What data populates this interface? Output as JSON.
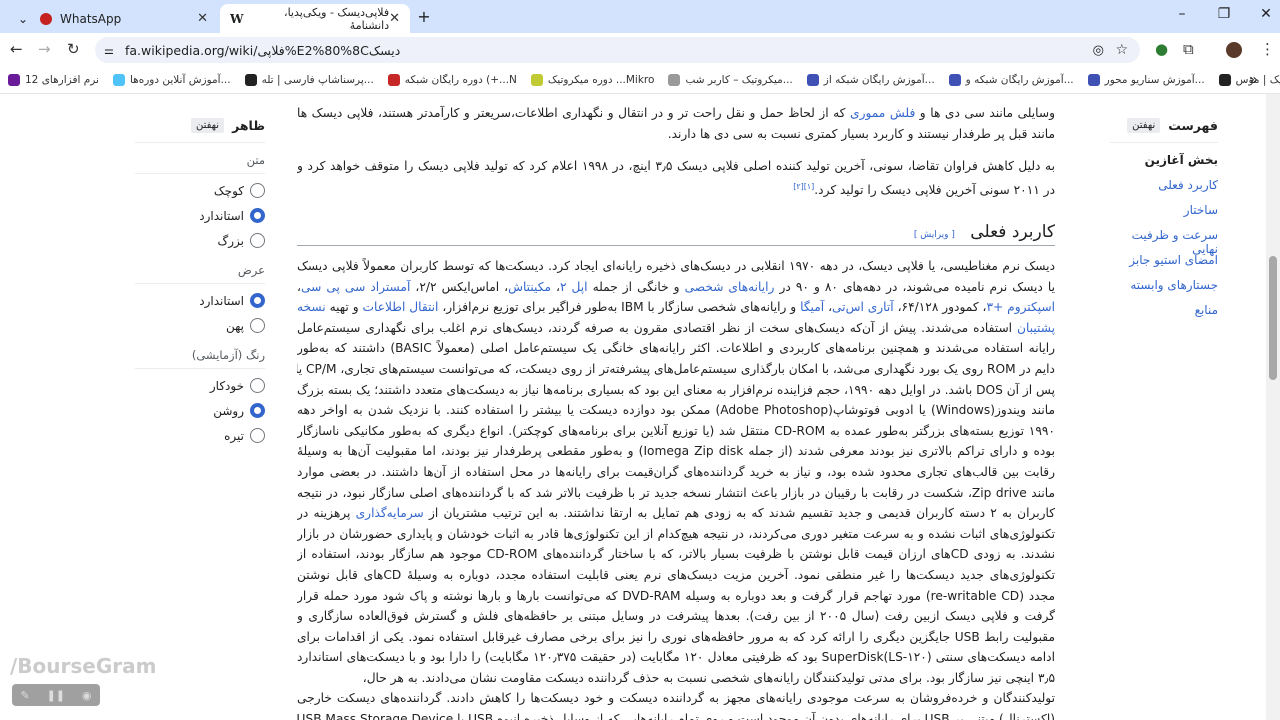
{
  "browser": {
    "tabs": [
      {
        "title": "WhatsApp",
        "active": false
      },
      {
        "title": "فلاپی‌دیسک - ویکی‌پدیا، دانشنامهٔ",
        "active": true
      }
    ],
    "url": "fa.wikipedia.org/wiki/فلاپی%E2%80%8Cدیسک",
    "bookmarks": [
      "نرم افزارهای 12",
      "آموزش آنلاین دوره‌ها...",
      "پرسناشاپ فارسی | تله...",
      "دوره رایگان شبکه (+...N",
      "دوره میکروتیک ...Mikro",
      "میکروتیک – کاربر شب...",
      "آموزش رایگان شبکه از...",
      "آموزش رایگان شبکه و...",
      "آموزش سناریو محور...",
      "یک میکروتیک | مؤس..."
    ],
    "more": "»"
  },
  "appearance": {
    "title": "ظاهر",
    "hide": "نهفتن",
    "groups": [
      {
        "label": "متن",
        "options": [
          {
            "label": "کوچک",
            "on": false
          },
          {
            "label": "استاندارد",
            "on": true
          },
          {
            "label": "بزرگ",
            "on": false
          }
        ]
      },
      {
        "label": "عرض",
        "options": [
          {
            "label": "استاندارد",
            "on": true
          },
          {
            "label": "پهن",
            "on": false
          }
        ]
      },
      {
        "label": "رنگ (آزمایشی)",
        "options": [
          {
            "label": "خودکار",
            "on": false
          },
          {
            "label": "روشن",
            "on": true
          },
          {
            "label": "تیره",
            "on": false
          }
        ]
      }
    ]
  },
  "toc": {
    "title": "فهرست",
    "hide": "نهفتن",
    "items": [
      "بخش آغازین",
      "کاربرد فعلی",
      "ساختار",
      "سرعت و ظرفیت نهایی",
      "امضای استیو جابز",
      "جستارهای وابسته",
      "منابع"
    ]
  },
  "article": {
    "p1": [
      [
        {
          "t": "وسایلی مانند سی دی ها و "
        },
        {
          "t": "فلش مموری",
          "link": true
        },
        {
          "t": " که از لحاظ حمل و نقل راحت تر و در انتقال و نگهداری اطلاعات،سریعتر و کارآمدتر هستند، فلاپی دیسک ها"
        }
      ],
      [
        {
          "t": "مانند قبل پر طرفدار نیستند و کاربرد بسیار کمتری نسبت به سی دی ها دارند."
        }
      ]
    ],
    "p2": [
      [
        {
          "t": "به دلیل کاهش فراوان تقاضا، سونی، آخرین تولید کننده اصلی فلاپی دیسک ۳٫۵ اینچ، در ۱۹۹۸ اعلام کرد که تولید فلاپی دیسک را متوقف خواهد کرد و"
        }
      ],
      [
        {
          "t": "در ۲۰۱۱ سونی آخرین فلاپی دیسک را تولید کرد."
        },
        {
          "t": "[۱][۲]",
          "sup": true
        }
      ]
    ],
    "heading": "کاربرد فعلی",
    "edit": "[ ویرایش ]",
    "p3": [
      [
        {
          "t": "دیسک نرم مغناطیسی، یا فلاپی دیسک، در دهه ۱۹۷۰ انقلابی در دیسک‌های ذخیره رایانه‌ای ایجاد کرد. دیسکت‌ها که توسط کاربران معمولاً فلاپی دیسک"
        }
      ],
      [
        {
          "t": "یا دیسک نرم نامیده می‌شوند، در دهه‌های ۸۰ و ۹۰ در "
        },
        {
          "t": "رایانه‌های شخصی",
          "link": true
        },
        {
          "t": " و خانگی از جمله "
        },
        {
          "t": "اپل ۲",
          "link": true
        },
        {
          "t": "، "
        },
        {
          "t": "مکینتاش",
          "link": true
        },
        {
          "t": "، اماس‌ایکس ۲/۲، "
        },
        {
          "t": "آمستراد سی پی سی",
          "link": true
        },
        {
          "t": "،"
        }
      ],
      [
        {
          "t": "اسپکتروم +۳",
          "link": true
        },
        {
          "t": "، کمودور ۶۴/۱۲۸، "
        },
        {
          "t": "آتاری اس‌تی",
          "link": true
        },
        {
          "t": "، "
        },
        {
          "t": "آمیگا",
          "link": true
        },
        {
          "t": " و رایانه‌های شخصی سازگار با IBM به‌طور فراگیر برای توزیع نرم‌افزار، "
        },
        {
          "t": "انتقال اطلاعات",
          "link": true
        },
        {
          "t": " و تهیه "
        },
        {
          "t": "نسخه",
          "link": true
        }
      ],
      [
        {
          "t": "پشتیبان",
          "link": true
        },
        {
          "t": " استفاده می‌شدند. پیش از آن‌که دیسک‌های سخت از نظر اقتصادی مقرون به صرفه گردند، دیسک‌های نرم اغلب برای نگهداری سیستم‌عامل"
        }
      ],
      [
        {
          "t": "رایانه استفاده می‌شدند و همچنین برنامه‌های کاربردی و اطلاعات. اکثر رایانه‌های خانگی یک سیستم‌عامل اصلی (معمولاً BASIC) داشتند که به‌طور"
        }
      ],
      [
        {
          "t": "دایم در ROM روی یک بورد نگهداری می‌شد، با امکان بارگذاری سیستم‌عامل‌های پیشرفته‌تر از روی دیسکت، که می‌توانست سیستم‌های تجاری، CP/M یا"
        }
      ],
      [
        {
          "t": "پس از آن DOS باشد. در اوایل دهه ۱۹۹۰، حجم فزاینده نرم‌افزار به معنای این بود که بسیاری برنامه‌ها نیاز به دیسکت‌های متعدد داشتند؛ یک بسته بزرگ"
        }
      ],
      [
        {
          "t": "مانند ویندوز(Windows) یا ادوبی فوتوشاپ(Adobe Photoshop) ممکن بود دوازده دیسکت یا بیشتر را استفاده کنند. با نزدیک شدن به اواخر دهه"
        }
      ],
      [
        {
          "t": "۱۹۹۰ توزیع بسته‌های بزرگتر به‌طور عمده به CD-ROM منتقل شد (یا توزیع آنلاین برای برنامه‌های کوچکتر). انواع دیگری که به‌طور مکانیکی ناسازگار"
        }
      ],
      [
        {
          "t": "بوده و دارای تراکم بالاتری نیز بودند معرفی شدند (از جمله Iomega Zip disk) و به‌طور مقطعی پرطرفدار نیز بودند، اما مقبولیت آن‌ها به وسیلهٔ"
        }
      ],
      [
        {
          "t": "رقابت بین قالب‌های تجاری محدود شده بود، و نیاز به خرید گرداننده‌های گران‌قیمت برای رایانه‌ها در محل استفاده از آن‌ها داشتند. در بعضی موارد"
        }
      ],
      [
        {
          "t": "مانند Zip drive، شکست در رقابت با رقیبان در بازار باعث انتشار نسخه جدید تر با ظرفیت بالاتر شد که با گرداننده‌های اصلی سازگار نبود، در نتیجه"
        }
      ],
      [
        {
          "t": "کاربران به ۲ دسته کاربران قدیمی و جدید تقسیم شدند که به زودی هم تمایل به ارتقا نداشتند. به این ترتیب مشتریان از "
        },
        {
          "t": "سرمایه‌گذاری",
          "link": true
        },
        {
          "t": " پرهزینه در"
        }
      ],
      [
        {
          "t": "تکنولوژی‌های اثبات نشده و به سرعت متغیر دوری می‌کردند، در نتیجه هیچ‌کدام از این تکنولوژی‌ها قادر به اثبات خودشان و پایداری حضورشان در بازار"
        }
      ],
      [
        {
          "t": "نشدند. به زودی CDهای ارزان قیمت قابل نوشتن با ظرفیت بسیار بالاتر، که با ساختار گرداننده‌های CD-ROM موجود هم سازگار بودند، استفاده از"
        }
      ],
      [
        {
          "t": "تکنولوژی‌های جدید دیسکت‌ها را غیر منطقی نمود. آخرین مزیت دیسک‌های نرم یعنی قابلیت استفاده مجدد، دوباره به وسیلهٔ CDهای قابل نوشتن"
        }
      ],
      [
        {
          "t": "مجدد (re-writable CD) مورد تهاجم قرار گرفت و بعد دوباره به وسیله DVD-RAM که می‌توانست بارها و بارها نوشته و پاک شود مورد حمله قرار"
        }
      ],
      [
        {
          "t": "گرفت و فلاپی دیسک ازبین رفت (سال ۲۰۰۵ از بین رفت). بعدها پیشرفت در وسایل مبتنی بر حافظه‌های فلش و گسترش فوق‌العاده سازگاری و"
        }
      ],
      [
        {
          "t": "مقبولیت رابط USB جایگزین دیگری را ارائه کرد که به مرور حافظه‌های نوری را نیز برای برخی مصارف غیرقابل استفاده نمود. یکی از اقدامات برای"
        }
      ],
      [
        {
          "t": "ادامه دیسکت‌های سنتی (SuperDisk(LS-۱۲۰ بود که ظرفیتی معادل ۱۲۰ مگابایت (در حقیقت ۱۲۰٫۳۷۵ مگابایت) را دارا بود و با دیسکت‌های استاندارد"
        }
      ],
      [
        {
          "t": "۳٫۵ اینچی نیز سازگار بود. برای مدتی تولیدکنندگان رایانه‌های شخصی نسبت به حذف گرداننده دیسکت مقاومت نشان می‌دادند. به هر حال،"
        }
      ],
      [
        {
          "t": "تولیدکنندگان و خرده‌فروشان به سرعت موجودی رایانه‌های مجهز به گرداننده دیسکت و خود دیسکت‌ها را کاهش دادند. گرداننده‌های دیسکت خارجی"
        }
      ],
      [
        {
          "t": "(اکسترنال) مبتنی بر USB برای رایانه‌های بدون آن موجود است و روی تمام رایانه‌هایی که از وسایل ذخیره انبوه USB یا USB Mass Storage Device"
        }
      ]
    ]
  },
  "watermark": "/BourseGram"
}
